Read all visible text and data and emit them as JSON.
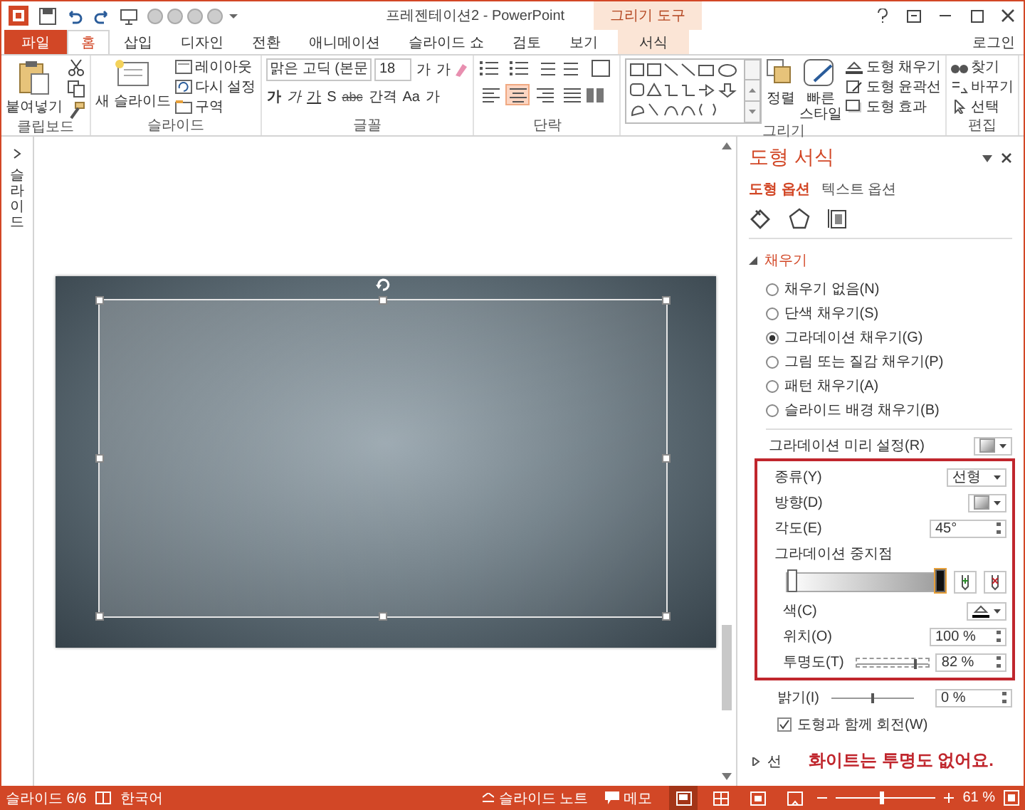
{
  "window": {
    "title": "프레젠테이션2 - PowerPoint",
    "context_tab_group": "그리기 도구"
  },
  "tabs": [
    {
      "label": "파일",
      "kind": "file",
      "selected": false
    },
    {
      "label": "홈",
      "kind": "normal",
      "selected": true
    },
    {
      "label": "삽입",
      "kind": "normal",
      "selected": false
    },
    {
      "label": "디자인",
      "kind": "normal",
      "selected": false
    },
    {
      "label": "전환",
      "kind": "normal",
      "selected": false
    },
    {
      "label": "애니메이션",
      "kind": "normal",
      "selected": false
    },
    {
      "label": "슬라이드 쇼",
      "kind": "normal",
      "selected": false
    },
    {
      "label": "검토",
      "kind": "normal",
      "selected": false
    },
    {
      "label": "보기",
      "kind": "normal",
      "selected": false
    },
    {
      "label": "서식",
      "kind": "context",
      "selected": false
    }
  ],
  "sign_in": "로그인",
  "ribbon": {
    "clipboard": {
      "label": "클립보드",
      "paste": "붙여넣기"
    },
    "slides": {
      "label": "슬라이드",
      "new_slide": "새 슬라이드",
      "layout": "레이아웃",
      "reset": "다시 설정",
      "section": "구역"
    },
    "font": {
      "label": "글꼴",
      "font_name": "맑은 고딕 (본문",
      "font_size": "18",
      "grow": "가",
      "shrink": "가",
      "bold": "가",
      "italic": "가",
      "underline": "가",
      "shadow": "S",
      "strike": "abc",
      "spacing": "간격",
      "case": "Aa",
      "font_color": "가"
    },
    "paragraph": {
      "label": "단락",
      "align": [
        {
          "selected": false
        },
        {
          "selected": true
        },
        {
          "selected": false
        },
        {
          "selected": false
        }
      ]
    },
    "drawing": {
      "label": "그리기",
      "arrange": "정렬",
      "quick_styles": "빠른 스타일",
      "fill": "도형 채우기",
      "outline": "도형 윤곽선",
      "effects": "도형 효과"
    },
    "editing": {
      "label": "편집",
      "find": "찾기",
      "replace": "바꾸기",
      "select": "선택"
    }
  },
  "thumbnail_pane": {
    "label": "슬라이드"
  },
  "format_pane": {
    "title": "도형 서식",
    "subtabs": [
      {
        "label": "도형 옵션",
        "selected": true
      },
      {
        "label": "텍스트 옵션",
        "selected": false
      }
    ],
    "fill": {
      "title": "채우기",
      "expanded": true,
      "options": [
        {
          "label": "채우기 없음(N)",
          "selected": false
        },
        {
          "label": "단색 채우기(S)",
          "selected": false
        },
        {
          "label": "그라데이션 채우기(G)",
          "selected": true
        },
        {
          "label": "그림 또는 질감 채우기(P)",
          "selected": false
        },
        {
          "label": "패턴 채우기(A)",
          "selected": false
        },
        {
          "label": "슬라이드 배경 채우기(B)",
          "selected": false
        }
      ],
      "preset_label": "그라데이션 미리 설정(R)",
      "type_label": "종류(Y)",
      "type_value": "선형",
      "direction_label": "방향(D)",
      "angle_label": "각도(E)",
      "angle_value": "45°",
      "stops_label": "그라데이션 중지점",
      "stops": [
        {
          "level": 0,
          "selected": false
        },
        {
          "level": 1,
          "selected": true
        }
      ],
      "color_label": "색(C)",
      "position_label": "위치(O)",
      "position_value": "100 %",
      "transparency_label": "투명도(T)",
      "transparency": {
        "level": 0.82
      },
      "transparency_value": "82 %",
      "brightness_label": "밝기(I)",
      "brightness": {
        "level": 0.5
      },
      "brightness_value": "0 %",
      "rotate_label": "도형과 함께 회전(W)",
      "rotate_checked": true
    },
    "line": {
      "title": "선",
      "expanded": false
    },
    "annotation": "화이트는 투명도 없어요."
  },
  "status_bar": {
    "slide": "슬라이드 6/6",
    "language": "한국어",
    "notes": "슬라이드 노트",
    "comments": "메모",
    "views": [
      {
        "selected": true
      },
      {
        "selected": false
      },
      {
        "selected": false
      },
      {
        "selected": false
      }
    ],
    "zoom": {
      "level": 0.45
    },
    "zoom_value": "61 %"
  }
}
